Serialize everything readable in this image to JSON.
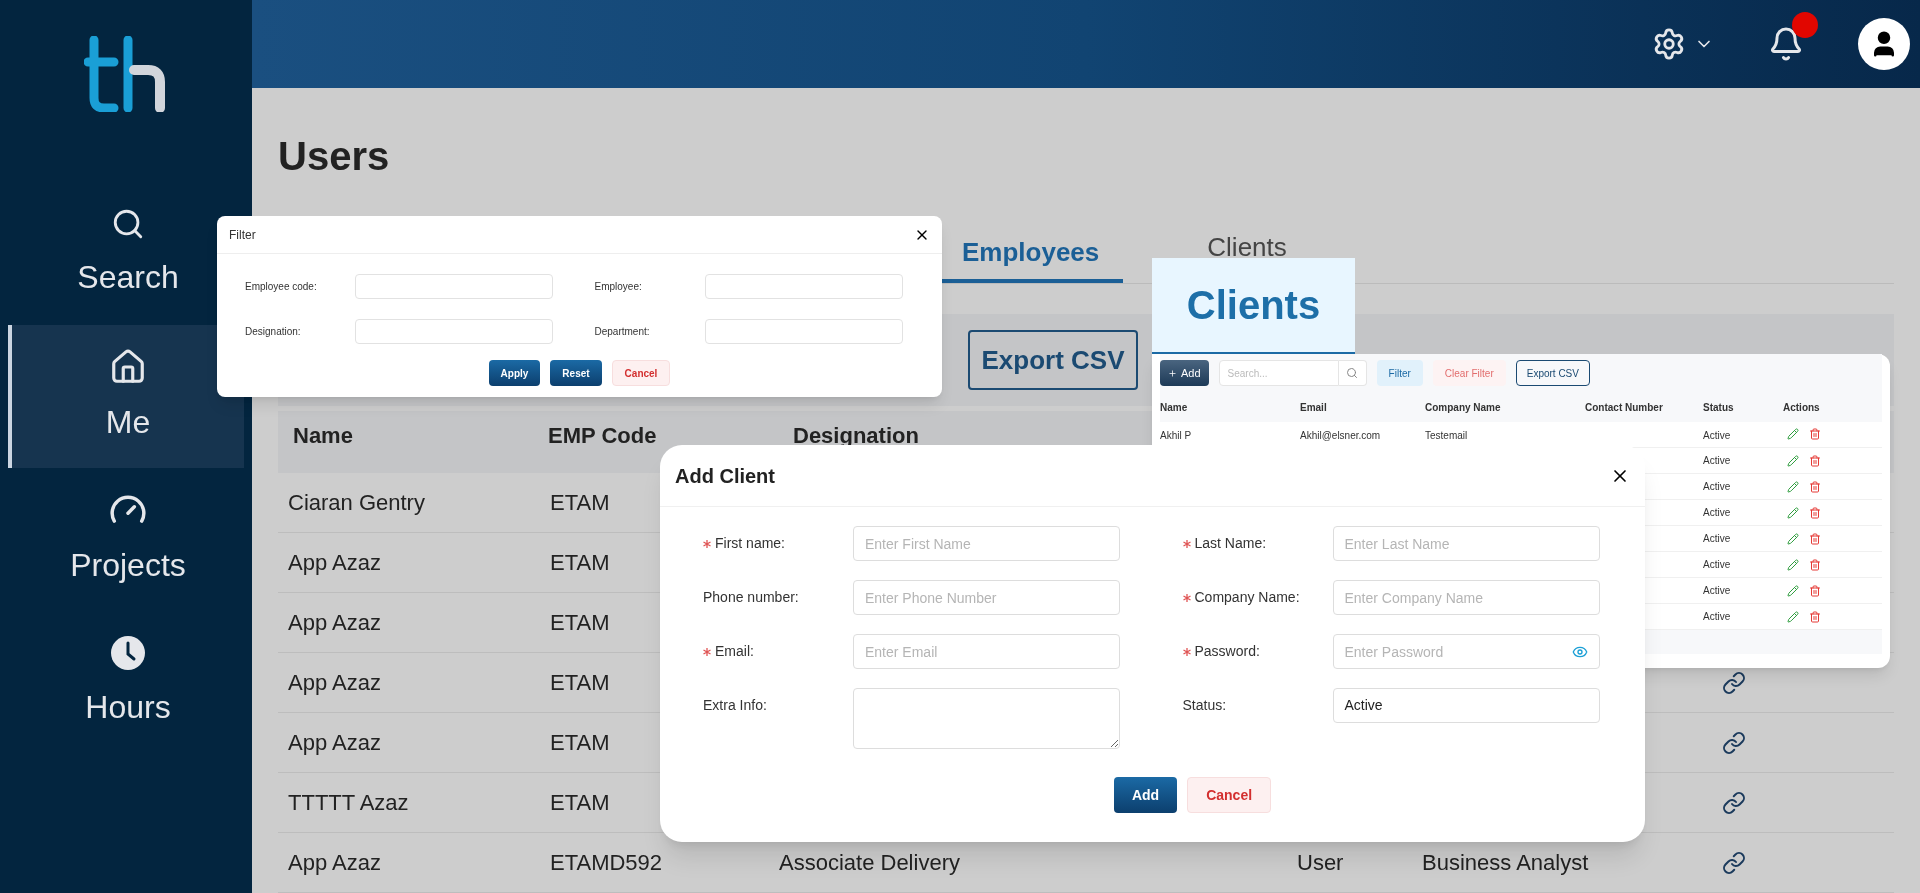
{
  "sidebar": {
    "items": [
      {
        "label": "Search",
        "selected": false
      },
      {
        "label": "Me",
        "selected": true
      },
      {
        "label": "Projects",
        "selected": false
      },
      {
        "label": "Hours",
        "selected": false
      }
    ]
  },
  "topbar": {
    "notifications": {
      "unread": true
    }
  },
  "page": {
    "title": "Users",
    "tabs": [
      {
        "label": "Employees",
        "selected": true
      },
      {
        "label": "Clients",
        "selected": false
      }
    ],
    "export_button": "Export CSV",
    "table": {
      "columns": [
        "Name",
        "EMP Code",
        "Designation"
      ],
      "rows": [
        {
          "name": "Ciaran Gentry",
          "emp_code": "ETAM"
        },
        {
          "name": "App Azaz",
          "emp_code": "ETAM"
        },
        {
          "name": "App Azaz",
          "emp_code": "ETAM"
        },
        {
          "name": "App Azaz",
          "emp_code": "ETAM",
          "link": true
        },
        {
          "name": "App Azaz",
          "emp_code": "ETAM",
          "link": true
        },
        {
          "name": "TTTTT Azaz",
          "emp_code": "ETAM",
          "link": true
        },
        {
          "name": "App Azaz",
          "emp_code": "ETAMD592",
          "designation": "Associate Delivery",
          "column_4": "User",
          "column_5": "Business Analyst",
          "link": true
        }
      ]
    }
  },
  "filter_dialog": {
    "title": "Filter",
    "fields": [
      {
        "label": "Employee code:"
      },
      {
        "label": "Employee:"
      },
      {
        "label": "Designation:"
      },
      {
        "label": "Department:"
      }
    ],
    "buttons": [
      {
        "label": "Apply",
        "kind": "primary"
      },
      {
        "label": "Reset",
        "kind": "primary"
      },
      {
        "label": "Cancel",
        "kind": "danger"
      }
    ]
  },
  "clients_panel": {
    "heading": "Clients",
    "add_button": "Add",
    "search": {
      "placeholder": "Search..."
    },
    "filter_button": "Filter",
    "clear_filter_button": "Clear Filter",
    "export_button": "Export CSV",
    "columns": [
      "Name",
      "Email",
      "Company Name",
      "Contact Number",
      "Status",
      "Actions"
    ],
    "rows": [
      {
        "name": "Akhil P",
        "email": "Akhil@elsner.com",
        "company": "Testemail",
        "status": "Active"
      },
      {
        "status": "Active"
      },
      {
        "status": "Active"
      },
      {
        "status": "Active"
      },
      {
        "status": "Active"
      },
      {
        "status": "Active"
      },
      {
        "status": "Active"
      },
      {
        "status": "Active"
      }
    ]
  },
  "add_client_dialog": {
    "title": "Add Client",
    "fields": [
      {
        "label": "First name:",
        "kind": "input",
        "required": true,
        "placeholder": "Enter First Name"
      },
      {
        "label": "Last Name:",
        "kind": "input",
        "required": true,
        "placeholder": "Enter Last Name"
      },
      {
        "label": "Phone number:",
        "kind": "input",
        "required": false,
        "placeholder": "Enter Phone Number"
      },
      {
        "label": "Company Name:",
        "kind": "input",
        "required": true,
        "placeholder": "Enter Company Name"
      },
      {
        "label": "Email:",
        "kind": "input",
        "required": true,
        "placeholder": "Enter Email"
      },
      {
        "label": "Password:",
        "kind": "password",
        "required": true,
        "placeholder": "Enter Password"
      },
      {
        "label": "Extra Info:",
        "kind": "textarea",
        "required": false
      },
      {
        "label": "Status:",
        "kind": "select",
        "required": false,
        "value": "Active"
      }
    ],
    "buttons": [
      {
        "label": "Add",
        "kind": "primary"
      },
      {
        "label": "Cancel",
        "kind": "danger"
      }
    ]
  }
}
